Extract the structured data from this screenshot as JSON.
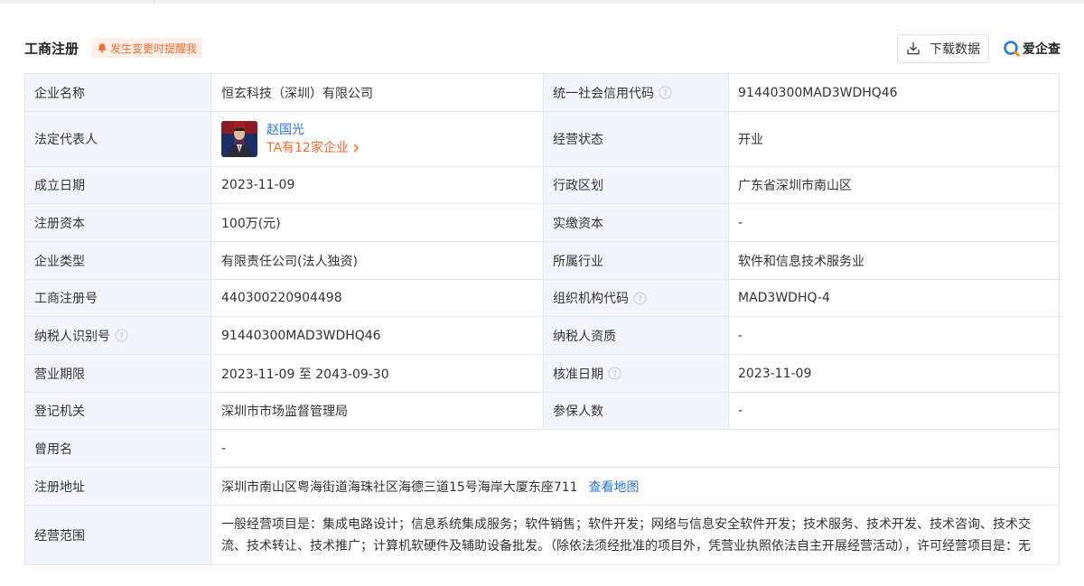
{
  "header": {
    "title": "工商注册",
    "remind_label": "发生变更时提醒我",
    "download_label": "下载数据",
    "brand_label": "爱企查"
  },
  "company": {
    "name_label": "企业名称",
    "name_value": "恒玄科技（深圳）有限公司",
    "credit_code_label": "统一社会信用代码",
    "credit_code_value": "91440300MAD3WDHQ46",
    "legal_rep_label": "法定代表人",
    "legal_rep_name": "赵国光",
    "legal_rep_more": "TA有12家企业",
    "status_label": "经营状态",
    "status_value": "开业",
    "founded_label": "成立日期",
    "founded_value": "2023-11-09",
    "region_label": "行政区划",
    "region_value": "广东省深圳市南山区",
    "reg_capital_label": "注册资本",
    "reg_capital_value": "100万(元)",
    "paid_capital_label": "实缴资本",
    "paid_capital_value": "-",
    "type_label": "企业类型",
    "type_value": "有限责任公司(法人独资)",
    "industry_label": "所属行业",
    "industry_value": "软件和信息技术服务业",
    "reg_no_label": "工商注册号",
    "reg_no_value": "440300220904498",
    "org_code_label": "组织机构代码",
    "org_code_value": "MAD3WDHQ-4",
    "taxpayer_id_label": "纳税人识别号",
    "taxpayer_id_value": "91440300MAD3WDHQ46",
    "taxpayer_qual_label": "纳税人资质",
    "taxpayer_qual_value": "-",
    "term_label": "营业期限",
    "term_value": "2023-11-09 至 2043-09-30",
    "approval_label": "核准日期",
    "approval_value": "2023-11-09",
    "authority_label": "登记机关",
    "authority_value": "深圳市市场监督管理局",
    "insured_label": "参保人数",
    "insured_value": "-",
    "former_name_label": "曾用名",
    "former_name_value": "-",
    "address_label": "注册地址",
    "address_value": "深圳市南山区粤海街道海珠社区海德三道15号海岸大厦东座711",
    "map_link": "查看地图",
    "scope_label": "经营范围",
    "scope_value": "一般经营项目是：集成电路设计；信息系统集成服务；软件销售；软件开发；网络与信息安全软件开发；技术服务、技术开发、技术咨询、技术交流、技术转让、技术推广；计算机软硬件及辅助设备批发。（除依法须经批准的项目外，凭营业执照依法自主开展经营活动），许可经营项目是：无"
  },
  "colors": {
    "label_bg": "#f2f6fc",
    "border": "#e4e8ef",
    "link": "#2677e7",
    "accent": "#ff6a2c"
  },
  "icons": [
    "bell-icon",
    "download-icon",
    "brand-logo-icon",
    "help-icon",
    "chevron-right-icon"
  ]
}
